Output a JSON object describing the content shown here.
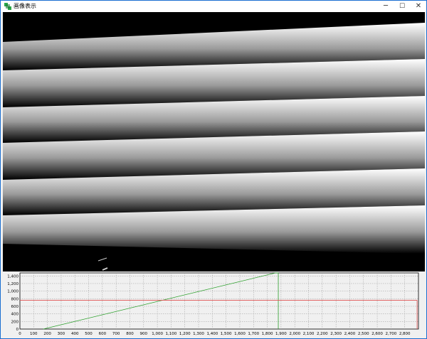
{
  "window": {
    "title": "画像表示",
    "icon": "green-app-icon",
    "controls": {
      "minimize": "─",
      "maximize": "☐",
      "close": "✕"
    }
  },
  "image_view": {
    "description_colors": {
      "background": "#000000",
      "stripe_light": "#ffffff",
      "stripe_dark": "#000000"
    }
  },
  "chart_data": {
    "type": "line",
    "x": [
      0,
      2850
    ],
    "xticks": [
      "0",
      "100",
      "200",
      "300",
      "400",
      "500",
      "600",
      "700",
      "800",
      "900",
      "1,000",
      "1,100",
      "1,200",
      "1,300",
      "1,400",
      "1,500",
      "1,600",
      "1,700",
      "1,800",
      "1,900",
      "2,000",
      "2,100",
      "2,200",
      "2,300",
      "2,400",
      "2,500",
      "2,600",
      "2,700",
      "2,800"
    ],
    "yticks": [
      "0",
      "200",
      "400",
      "600",
      "800",
      "1,000",
      "1,200",
      "1,400"
    ],
    "xlim": [
      0,
      2900
    ],
    "ylim": [
      0,
      1480
    ],
    "grid": true,
    "series": [
      {
        "color": "#2ca02c",
        "points": [
          [
            170,
            0
          ],
          [
            1860,
            1480
          ]
        ],
        "drop_line_x": 1880
      },
      {
        "color": "#e05050",
        "points": [
          [
            0,
            760
          ],
          [
            2890,
            760
          ]
        ],
        "drop_line_x": 2890
      }
    ],
    "title": "",
    "xlabel": "",
    "ylabel": ""
  }
}
